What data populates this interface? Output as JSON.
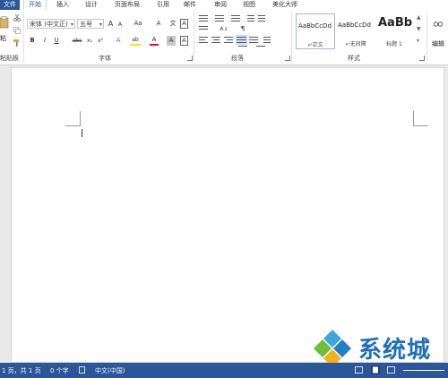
{
  "tabs": {
    "file": "文件",
    "home": "开始",
    "insert": "插入",
    "design": "设计",
    "layout": "页面布局",
    "references": "引用",
    "mailings": "邮件",
    "review": "审阅",
    "view": "视图",
    "beautify": "美化大师"
  },
  "clipboard": {
    "paste_label": "粘",
    "group_label": "粘贴板"
  },
  "font": {
    "name": "宋体 (中文正)",
    "size": "五号",
    "grow": "A",
    "shrink": "A",
    "case": "Aa",
    "clear": "A",
    "phonetic": "文",
    "border": "A",
    "bold": "B",
    "italic": "I",
    "underline": "U",
    "strike": "abc",
    "subscript": "x₂",
    "superscript": "x²",
    "effects": "A",
    "highlight": "ab",
    "color": "A",
    "shading": "A",
    "char_border": "A",
    "group_label": "字体"
  },
  "paragraph": {
    "group_label": "段落",
    "sort": "A↓",
    "show_marks": "¶"
  },
  "styles": {
    "group_label": "样式",
    "items": [
      {
        "sample": "AaBbCcDd",
        "name": "↵正文"
      },
      {
        "sample": "AaBbCcDd",
        "name": "↵无间隔"
      },
      {
        "sample": "AaBb",
        "name": "标题 1"
      }
    ]
  },
  "editing": {
    "label": "编辑"
  },
  "status": {
    "page": "1 页，共 1 页",
    "words": "0 个字",
    "language": "中文(中国)"
  },
  "colors": {
    "accent": "#2b579a",
    "font_red": "#e81123",
    "highlight_yellow": "#ffe400"
  },
  "watermark": {
    "text": "系统城"
  }
}
